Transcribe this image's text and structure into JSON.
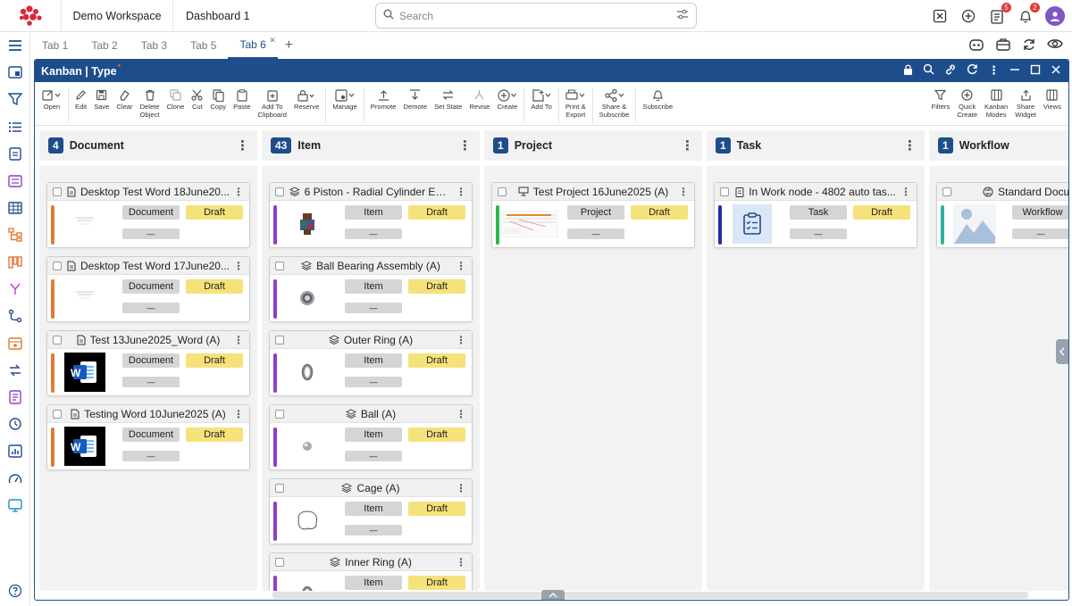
{
  "header": {
    "workspace": "Demo Workspace",
    "dashboard": "Dashboard 1",
    "search_placeholder": "Search",
    "badges": {
      "tasks": "5",
      "notifications": "2"
    }
  },
  "tabs": [
    {
      "label": "Tab 1",
      "active": false
    },
    {
      "label": "Tab 2",
      "active": false
    },
    {
      "label": "Tab 3",
      "active": false
    },
    {
      "label": "Tab 5",
      "active": false
    },
    {
      "label": "Tab 6",
      "active": true
    }
  ],
  "widget": {
    "title": "Kanban | Type",
    "unsaved_marker": "*"
  },
  "toolbar": {
    "open": "Open",
    "edit": "Edit",
    "save": "Save",
    "clear": "Clear",
    "delete_l1": "Delete",
    "delete_l2": "Object",
    "clone": "Clone",
    "cut": "Cut",
    "copy": "Copy",
    "paste": "Paste",
    "addclip_l1": "Add To",
    "addclip_l2": "Clipboard",
    "reserve": "Reserve",
    "manage": "Manage",
    "promote": "Promote",
    "demote": "Demote",
    "setstate": "Set State",
    "revise": "Revise",
    "create": "Create",
    "addto": "Add To",
    "print_l1": "Print &",
    "print_l2": "Export",
    "share_l1": "Share &",
    "share_l2": "Subscribe",
    "subscribe": "Subscribe",
    "filters": "Filters",
    "quick_l1": "Quick",
    "quick_l2": "Create",
    "kmodes_l1": "Kanban",
    "kmodes_l2": "Modes",
    "sharew_l1": "Share",
    "sharew_l2": "Widget",
    "views": "Views"
  },
  "colors": {
    "brand": "#1e4d8c",
    "draft": "#f5e27b",
    "doc_strip": "#e07b39",
    "item_strip": "#8e3fc4",
    "project_strip": "#2db84d",
    "task_strip": "#1c2fa8",
    "workflow_strip": "#2bb3a0"
  },
  "columns": [
    {
      "count": "4",
      "name": "Document",
      "cards": [
        {
          "title": "Desktop Test Word 18June20...",
          "type": "Document",
          "state": "Draft",
          "lower": "—",
          "thumb": "doc-page-icon"
        },
        {
          "title": "Desktop Test Word 17June20...",
          "type": "Document",
          "state": "Draft",
          "lower": "—",
          "thumb": "doc-page-icon"
        },
        {
          "title": "Test 13June2025_Word (A)",
          "type": "Document",
          "state": "Draft",
          "lower": "—",
          "thumb": "word-icon",
          "word": "W"
        },
        {
          "title": "Testing Word 10June2025 (A)",
          "type": "Document",
          "state": "Draft",
          "lower": "—",
          "thumb": "word-icon",
          "word": "W"
        }
      ]
    },
    {
      "count": "43",
      "name": "Item",
      "cards": [
        {
          "title": "6 Piston - Radial Cylinder Eng...",
          "type": "Item",
          "state": "Draft",
          "lower": "—",
          "thumb": "engine-part-icon"
        },
        {
          "title": "Ball Bearing Assembly (A)",
          "type": "Item",
          "state": "Draft",
          "lower": "—",
          "thumb": "bearing-icon"
        },
        {
          "title": "Outer Ring (A)",
          "type": "Item",
          "state": "Draft",
          "lower": "—",
          "thumb": "ring-icon"
        },
        {
          "title": "Ball (A)",
          "type": "Item",
          "state": "Draft",
          "lower": "—",
          "thumb": "ball-icon"
        },
        {
          "title": "Cage (A)",
          "type": "Item",
          "state": "Draft",
          "lower": "—",
          "thumb": "cage-icon"
        },
        {
          "title": "Inner Ring (A)",
          "type": "Item",
          "state": "Draft",
          "lower": "—",
          "thumb": "ring-icon"
        }
      ]
    },
    {
      "count": "1",
      "name": "Project",
      "cards": [
        {
          "title": "Test Project 16June2025 (A)",
          "type": "Project",
          "state": "Draft",
          "lower": "—",
          "thumb": "gantt-thumb-icon"
        }
      ]
    },
    {
      "count": "1",
      "name": "Task",
      "cards": [
        {
          "title": "In Work node - 4802 auto tas...",
          "type": "Task",
          "state": "Draft",
          "lower": "—",
          "thumb": "clipboard-check-icon"
        }
      ]
    },
    {
      "count": "1",
      "name": "Workflow",
      "cards": [
        {
          "title": "Standard Document",
          "type": "Workflow",
          "state": "",
          "lower": "—",
          "thumb": "image-placeholder-icon"
        }
      ]
    }
  ]
}
